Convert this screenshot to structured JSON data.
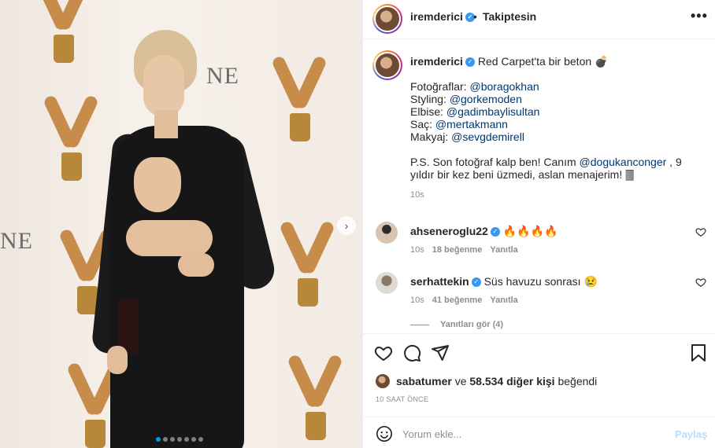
{
  "post": {
    "username": "iremderici",
    "follow_separator": "•",
    "follow_label": "Takiptesin",
    "more_label": "•••",
    "carousel": {
      "slide_count": 7,
      "active_index": 0,
      "next_glyph": "›"
    }
  },
  "caption": {
    "username": "iremderici",
    "text": "Red Carpet'ta bir beton 💣",
    "credits": [
      {
        "label": "Fotoğraflar: ",
        "mention": "@boragokhan"
      },
      {
        "label": "Styling: ",
        "mention": "@gorkemoden"
      },
      {
        "label": "Elbise: ",
        "mention": "@gadimbaylisultan"
      },
      {
        "label": "Saç: ",
        "mention": "@mertakmann"
      },
      {
        "label": "Makyaj: ",
        "mention": "@sevgdemirell"
      }
    ],
    "ps_prefix": "P.S. Son fotoğraf kalp ben! Canım ",
    "ps_mention": "@dogukanconger",
    "ps_suffix": " , 9 yıldır bir kez beni üzmedi, aslan menajerim! 🀫",
    "time": "10s"
  },
  "comments": [
    {
      "username": "ahseneroglu22",
      "text": "🔥🔥🔥🔥",
      "time": "10s",
      "likes": "18 beğenme",
      "reply": "Yanıtla"
    },
    {
      "username": "serhattekin",
      "text": "Süs havuzu sonrası 😢",
      "time": "10s",
      "likes": "41 beğenme",
      "reply": "Yanıtla"
    }
  ],
  "replies_label": "Yanıtları gör (4)",
  "likes": {
    "user": "sabatumer",
    "connector": "ve",
    "others": "58.534 diğer kişi",
    "suffix": "beğendi"
  },
  "time_ago": "10 SAAT ÖNCE",
  "add_comment": {
    "placeholder": "Yorum ekle...",
    "post_label": "Paylaş"
  },
  "photo": {
    "logo_text": "NE"
  },
  "colors": {
    "accent": "#0095f6",
    "verified": "#3897f0",
    "link": "#00376b",
    "muted": "#8e8e8e"
  }
}
